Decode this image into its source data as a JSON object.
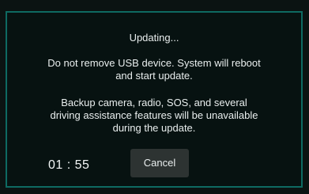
{
  "dialog": {
    "title": "Updating...",
    "message1": {
      "line1": "Do not remove USB device. System will reboot",
      "line2": "and start update."
    },
    "message2": {
      "line1": "Backup camera, radio, SOS, and several",
      "line2": "driving assistance features will be unavailable",
      "line3": "during the update."
    },
    "timer": "01 : 55",
    "cancel_label": "Cancel"
  }
}
